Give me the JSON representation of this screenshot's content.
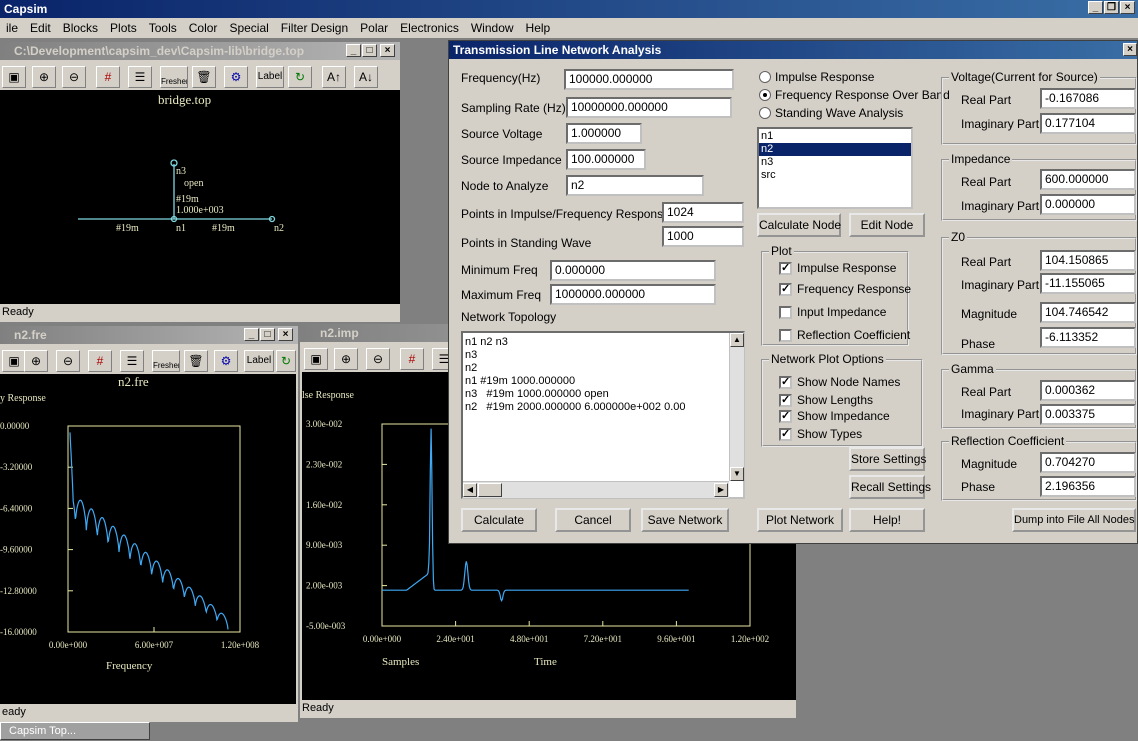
{
  "app": {
    "title": "Capsim",
    "menu": [
      "ile",
      "Edit",
      "Blocks",
      "Plots",
      "Tools",
      "Color",
      "Special",
      "Filter Design",
      "Polar",
      "Electronics",
      "Window",
      "Help"
    ]
  },
  "bridge_window": {
    "title": "C:\\Development\\capsim_dev\\Capsim-lib\\bridge.top",
    "canvas_title": "bridge.top",
    "nodes": {
      "n3": "n3",
      "open": "open",
      "n3_len": "#19m",
      "n3_val": "1.000e+003",
      "left_len": "#19m",
      "n1": "n1",
      "right_len": "#19m",
      "n2": "n2"
    },
    "status": "Ready"
  },
  "toolbar": {
    "freshen": "Freshen",
    "label": "Label"
  },
  "fre_window": {
    "title": "n2.fre",
    "plot_title": "n2.fre",
    "ylabel": "y Response",
    "xlabel": "Frequency",
    "yticks": [
      "0.00000",
      "-3.20000",
      "-6.40000",
      "-9.60000",
      "-12.80000",
      "-16.00000"
    ],
    "xticks": [
      "0.00e+000",
      "6.00e+007",
      "1.20e+008"
    ],
    "status": "eady"
  },
  "imp_window": {
    "title": "n2.imp",
    "ylabel": "lse Response",
    "xlabel": "Samples",
    "xlabel2": "Time",
    "yticks": [
      "3.00e-002",
      "2.30e-002",
      "1.60e-002",
      "9.00e-003",
      "2.00e-003",
      "-5.00e-003"
    ],
    "xticks": [
      "0.00e+000",
      "2.40e+001",
      "4.80e+001",
      "7.20e+001",
      "9.60e+001",
      "1.20e+002"
    ],
    "status": "Ready"
  },
  "dialog": {
    "title": "Transmission Line Network Analysis",
    "frequency_label": "Frequency(Hz)",
    "frequency_value": "100000.000000",
    "sampling_label": "Sampling Rate (Hz)",
    "sampling_value": "10000000.000000",
    "voltage_label": "Source Voltage",
    "voltage_value": "1.000000",
    "impedance_label": "Source Impedance",
    "impedance_value": "100.000000",
    "node_label": "Node to Analyze",
    "node_value": "n2",
    "points_resp_label": "Points in Impulse/Frequency Response",
    "points_resp_value": "1024",
    "points_wave_label": "Points in Standing Wave",
    "points_wave_value": "1000",
    "min_freq_label": "Minimum Freq",
    "min_freq_value": "0.000000",
    "max_freq_label": "Maximum Freq",
    "max_freq_value": "1000000.000000",
    "topology_label": "Network Topology",
    "topology_lines": [
      "n1 n2 n3",
      "n3",
      "n2",
      "n1 #19m 1000.000000",
      "n3   #19m 1000.000000 open",
      "n2   #19m 2000.000000 6.000000e+002 0.00"
    ],
    "radios": [
      "Impulse Response",
      "Frequency Response Over Band",
      "Standing Wave Analysis"
    ],
    "radio_selected": 1,
    "node_list": [
      "n1",
      "n2",
      "n3",
      "src"
    ],
    "node_selected": 1,
    "calc_node": "Calculate Node",
    "edit_node": "Edit Node",
    "plot_group": "Plot",
    "plot_checks": [
      {
        "label": "Impulse Response",
        "checked": true
      },
      {
        "label": "Frequency Response",
        "checked": true
      },
      {
        "label": "Input Impedance",
        "checked": false
      },
      {
        "label": "Reflection Coefficient",
        "checked": false
      }
    ],
    "netopt_group": "Network Plot Options",
    "netopt_checks": [
      {
        "label": "Show Node Names",
        "checked": true
      },
      {
        "label": "Show Lengths",
        "checked": true
      },
      {
        "label": "Show Impedance",
        "checked": true
      },
      {
        "label": "Show Types",
        "checked": true
      }
    ],
    "store_settings": "Store Settings",
    "recall_settings": "Recall Settings",
    "buttons": {
      "calculate": "Calculate",
      "cancel": "Cancel",
      "save_network": "Save Network",
      "plot_network": "Plot Network",
      "help": "Help!",
      "dump": "Dump into File All Nodes"
    },
    "voltage_group": "Voltage(Current for Source)",
    "imped_group": "Impedance",
    "z0_group": "Z0",
    "gamma_group": "Gamma",
    "refl_group": "Reflection Coefficient",
    "real_part": "Real Part",
    "imag_part": "Imaginary Part",
    "magnitude": "Magnitude",
    "phase": "Phase",
    "voltage_real": "-0.167086",
    "voltage_imag": "0.177104",
    "imped_real": "600.000000",
    "imped_imag": "0.000000",
    "z0_real": "104.150865",
    "z0_imag": "-11.155065",
    "z0_mag": "104.746542",
    "z0_phase": "-6.113352",
    "gamma_real": "0.000362",
    "gamma_imag": "0.003375",
    "refl_mag": "0.704270",
    "refl_phase": "2.196356"
  },
  "taskbar": {
    "item": "Capsim Top..."
  },
  "colors": {
    "plot_line": "#3fa9f5",
    "plot_axes": "#e8e8a0",
    "circuit": "#7fd8e0",
    "text": "#e8e8c0"
  }
}
